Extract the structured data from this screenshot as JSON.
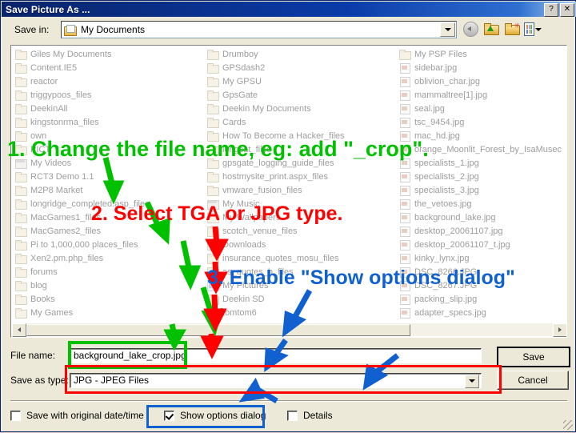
{
  "window": {
    "title": "Save Picture As ...",
    "help_button": "?",
    "close_button": "✕"
  },
  "savein": {
    "label": "Save in:",
    "value": "My Documents",
    "icon": "folder-documents-icon"
  },
  "toolbar": {
    "back": "back-icon",
    "up_folder": "up-one-level-icon",
    "new_folder": "create-new-folder-icon",
    "views": "views-icon"
  },
  "filelist": {
    "column1": [
      {
        "name": "Giles My Documents",
        "type": "folder"
      },
      {
        "name": "Content.IE5",
        "type": "folder"
      },
      {
        "name": "reactor",
        "type": "folder"
      },
      {
        "name": "triggypoos_files",
        "type": "folder"
      },
      {
        "name": "DeekinAll",
        "type": "folder"
      },
      {
        "name": "kingstonrma_files",
        "type": "folder"
      },
      {
        "name": "own",
        "type": "folder"
      },
      {
        "name": "PICT",
        "type": "folder"
      },
      {
        "name": "My Videos",
        "type": "vid"
      },
      {
        "name": "RCT3 Demo 1.1",
        "type": "folder"
      },
      {
        "name": "M2P8 Market",
        "type": "folder"
      },
      {
        "name": "longridge_completed.asp_files",
        "type": "folder"
      },
      {
        "name": "MacGames1_files",
        "type": "folder"
      },
      {
        "name": "MacGames2_files",
        "type": "folder"
      },
      {
        "name": "Pi to 1,000,000 places_files",
        "type": "folder"
      },
      {
        "name": "Xen2.pm.php_files",
        "type": "folder"
      },
      {
        "name": "forums",
        "type": "folder"
      },
      {
        "name": "blog",
        "type": "folder"
      },
      {
        "name": "Books",
        "type": "folder"
      },
      {
        "name": "My Games",
        "type": "folder"
      }
    ],
    "column2": [
      {
        "name": "Drumboy",
        "type": "folder"
      },
      {
        "name": "GPSdash2",
        "type": "folder"
      },
      {
        "name": "My GPSU",
        "type": "folder"
      },
      {
        "name": "GpsGate",
        "type": "folder"
      },
      {
        "name": "Deekin My Documents",
        "type": "folder"
      },
      {
        "name": "Cards",
        "type": "folder"
      },
      {
        "name": "How To Become a Hacker_files",
        "type": "folder"
      },
      {
        "name": "longcat_files",
        "type": "folder"
      },
      {
        "name": "gpsgate_logging_guide_files",
        "type": "folder"
      },
      {
        "name": "hostmysite_print.aspx_files",
        "type": "folder"
      },
      {
        "name": "vmware_fusion_files",
        "type": "folder"
      },
      {
        "name": "My Music",
        "type": "vid"
      },
      {
        "name": "My Wallpapers",
        "type": "folder"
      },
      {
        "name": "scotch_venue_files",
        "type": "folder"
      },
      {
        "name": "Downloads",
        "type": "folder"
      },
      {
        "name": "insurance_quotes_mosu_files",
        "type": "folder"
      },
      {
        "name": "as_quotes_b_files",
        "type": "folder"
      },
      {
        "name": "My Pictures",
        "type": "pic"
      },
      {
        "name": "Deekin SD",
        "type": "folder"
      },
      {
        "name": "tomtom6",
        "type": "folder"
      }
    ],
    "column3": [
      {
        "name": "My PSP Files",
        "type": "folder"
      },
      {
        "name": "sidebar.jpg",
        "type": "img"
      },
      {
        "name": "oblivion_char.jpg",
        "type": "img"
      },
      {
        "name": "mammaltree[1].jpg",
        "type": "img"
      },
      {
        "name": "seal.jpg",
        "type": "img"
      },
      {
        "name": "tsc_9454.jpg",
        "type": "img"
      },
      {
        "name": "mac_hd.jpg",
        "type": "img"
      },
      {
        "name": "orange_Moonlit_Forest_by_IsaMusec",
        "type": "img"
      },
      {
        "name": "specialists_1.jpg",
        "type": "img"
      },
      {
        "name": "specialists_2.jpg",
        "type": "img"
      },
      {
        "name": "specialists_3.jpg",
        "type": "img"
      },
      {
        "name": "the_vetoes.jpg",
        "type": "img"
      },
      {
        "name": "background_lake.jpg",
        "type": "img"
      },
      {
        "name": "desktop_20061107.jpg",
        "type": "img"
      },
      {
        "name": "desktop_20061107_t.jpg",
        "type": "img"
      },
      {
        "name": "kinky_lynx.jpg",
        "type": "img"
      },
      {
        "name": "DSC_8266.JPG",
        "type": "img"
      },
      {
        "name": "DSC_8267.JPG",
        "type": "img"
      },
      {
        "name": "packing_slip.jpg",
        "type": "img"
      },
      {
        "name": "adapter_specs.jpg",
        "type": "img"
      }
    ]
  },
  "form": {
    "filename_label": "File name:",
    "filename_value": "background_lake_crop.jpg",
    "savetype_label": "Save as type:",
    "savetype_value": "JPG - JPEG Files",
    "save_button": "Save",
    "cancel_button": "Cancel"
  },
  "checkboxes": {
    "orig_date": {
      "label": "Save with original date/time",
      "checked": false
    },
    "show_options": {
      "label": "Show options dialog",
      "checked": true
    },
    "details": {
      "label": "Details",
      "checked": false
    }
  },
  "annotations": [
    {
      "text": "1. Change the file name, eg: add \"_crop\".",
      "color": "#00c000"
    },
    {
      "text": "2. Select TGA or JPG type.",
      "color": "#ff0000"
    },
    {
      "text": "3. Enable \"Show options dialog\"",
      "color": "#1060d0"
    }
  ],
  "colors": {
    "green": "#00c000",
    "red": "#ff0000",
    "blue": "#1060d0",
    "title_blue": "#0a246a",
    "dialog_face": "#ece9d8"
  }
}
